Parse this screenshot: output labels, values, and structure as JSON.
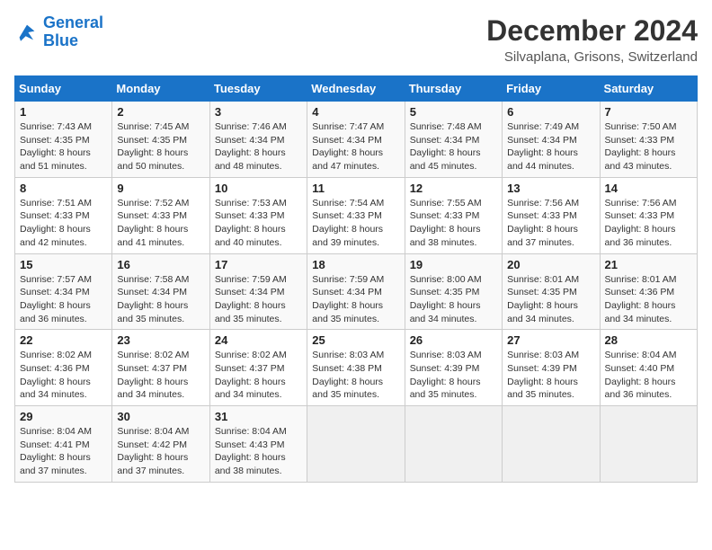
{
  "logo": {
    "line1": "General",
    "line2": "Blue"
  },
  "title": "December 2024",
  "subtitle": "Silvaplana, Grisons, Switzerland",
  "weekdays": [
    "Sunday",
    "Monday",
    "Tuesday",
    "Wednesday",
    "Thursday",
    "Friday",
    "Saturday"
  ],
  "weeks": [
    [
      {
        "day": "1",
        "sunrise": "7:43 AM",
        "sunset": "4:35 PM",
        "daylight": "8 hours and 51 minutes."
      },
      {
        "day": "2",
        "sunrise": "7:45 AM",
        "sunset": "4:35 PM",
        "daylight": "8 hours and 50 minutes."
      },
      {
        "day": "3",
        "sunrise": "7:46 AM",
        "sunset": "4:34 PM",
        "daylight": "8 hours and 48 minutes."
      },
      {
        "day": "4",
        "sunrise": "7:47 AM",
        "sunset": "4:34 PM",
        "daylight": "8 hours and 47 minutes."
      },
      {
        "day": "5",
        "sunrise": "7:48 AM",
        "sunset": "4:34 PM",
        "daylight": "8 hours and 45 minutes."
      },
      {
        "day": "6",
        "sunrise": "7:49 AM",
        "sunset": "4:34 PM",
        "daylight": "8 hours and 44 minutes."
      },
      {
        "day": "7",
        "sunrise": "7:50 AM",
        "sunset": "4:33 PM",
        "daylight": "8 hours and 43 minutes."
      }
    ],
    [
      {
        "day": "8",
        "sunrise": "7:51 AM",
        "sunset": "4:33 PM",
        "daylight": "8 hours and 42 minutes."
      },
      {
        "day": "9",
        "sunrise": "7:52 AM",
        "sunset": "4:33 PM",
        "daylight": "8 hours and 41 minutes."
      },
      {
        "day": "10",
        "sunrise": "7:53 AM",
        "sunset": "4:33 PM",
        "daylight": "8 hours and 40 minutes."
      },
      {
        "day": "11",
        "sunrise": "7:54 AM",
        "sunset": "4:33 PM",
        "daylight": "8 hours and 39 minutes."
      },
      {
        "day": "12",
        "sunrise": "7:55 AM",
        "sunset": "4:33 PM",
        "daylight": "8 hours and 38 minutes."
      },
      {
        "day": "13",
        "sunrise": "7:56 AM",
        "sunset": "4:33 PM",
        "daylight": "8 hours and 37 minutes."
      },
      {
        "day": "14",
        "sunrise": "7:56 AM",
        "sunset": "4:33 PM",
        "daylight": "8 hours and 36 minutes."
      }
    ],
    [
      {
        "day": "15",
        "sunrise": "7:57 AM",
        "sunset": "4:34 PM",
        "daylight": "8 hours and 36 minutes."
      },
      {
        "day": "16",
        "sunrise": "7:58 AM",
        "sunset": "4:34 PM",
        "daylight": "8 hours and 35 minutes."
      },
      {
        "day": "17",
        "sunrise": "7:59 AM",
        "sunset": "4:34 PM",
        "daylight": "8 hours and 35 minutes."
      },
      {
        "day": "18",
        "sunrise": "7:59 AM",
        "sunset": "4:34 PM",
        "daylight": "8 hours and 35 minutes."
      },
      {
        "day": "19",
        "sunrise": "8:00 AM",
        "sunset": "4:35 PM",
        "daylight": "8 hours and 34 minutes."
      },
      {
        "day": "20",
        "sunrise": "8:01 AM",
        "sunset": "4:35 PM",
        "daylight": "8 hours and 34 minutes."
      },
      {
        "day": "21",
        "sunrise": "8:01 AM",
        "sunset": "4:36 PM",
        "daylight": "8 hours and 34 minutes."
      }
    ],
    [
      {
        "day": "22",
        "sunrise": "8:02 AM",
        "sunset": "4:36 PM",
        "daylight": "8 hours and 34 minutes."
      },
      {
        "day": "23",
        "sunrise": "8:02 AM",
        "sunset": "4:37 PM",
        "daylight": "8 hours and 34 minutes."
      },
      {
        "day": "24",
        "sunrise": "8:02 AM",
        "sunset": "4:37 PM",
        "daylight": "8 hours and 34 minutes."
      },
      {
        "day": "25",
        "sunrise": "8:03 AM",
        "sunset": "4:38 PM",
        "daylight": "8 hours and 35 minutes."
      },
      {
        "day": "26",
        "sunrise": "8:03 AM",
        "sunset": "4:39 PM",
        "daylight": "8 hours and 35 minutes."
      },
      {
        "day": "27",
        "sunrise": "8:03 AM",
        "sunset": "4:39 PM",
        "daylight": "8 hours and 35 minutes."
      },
      {
        "day": "28",
        "sunrise": "8:04 AM",
        "sunset": "4:40 PM",
        "daylight": "8 hours and 36 minutes."
      }
    ],
    [
      {
        "day": "29",
        "sunrise": "8:04 AM",
        "sunset": "4:41 PM",
        "daylight": "8 hours and 37 minutes."
      },
      {
        "day": "30",
        "sunrise": "8:04 AM",
        "sunset": "4:42 PM",
        "daylight": "8 hours and 37 minutes."
      },
      {
        "day": "31",
        "sunrise": "8:04 AM",
        "sunset": "4:43 PM",
        "daylight": "8 hours and 38 minutes."
      },
      null,
      null,
      null,
      null
    ]
  ],
  "labels": {
    "sunrise": "Sunrise:",
    "sunset": "Sunset:",
    "daylight": "Daylight:"
  }
}
